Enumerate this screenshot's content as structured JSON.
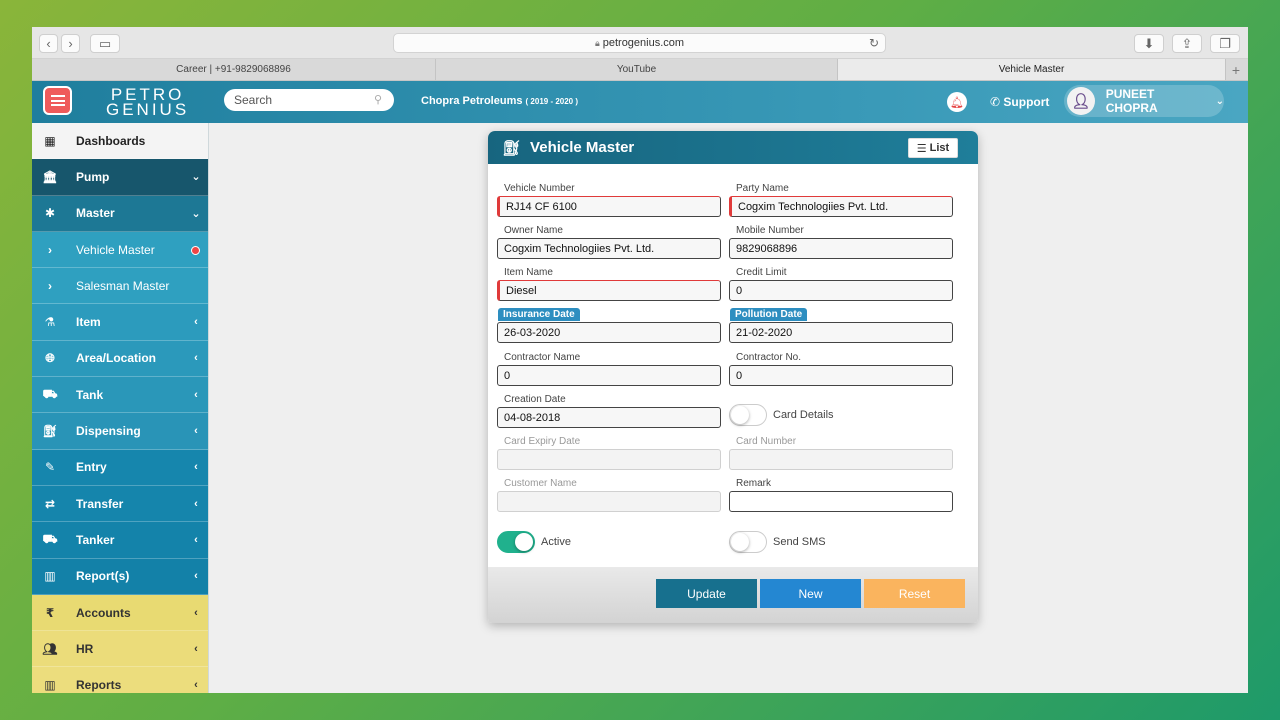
{
  "browser": {
    "url": "petrogenius.com",
    "tabs": [
      "Career | +91-9829068896",
      "YouTube",
      "Vehicle Master"
    ],
    "active_tab": 2
  },
  "header": {
    "logo_line1": "PETRO",
    "logo_line2": "GENIUS",
    "search_placeholder": "Search",
    "company": "Chopra Petroleums",
    "year": "( 2019 - 2020 )",
    "support_label": "Support",
    "user_name": "PUNEET CHOPRA"
  },
  "sidebar": {
    "items": [
      {
        "label": "Dashboards",
        "icon": "grid-icon",
        "caret": "",
        "bg": "#f4f4f4",
        "fg": "#222"
      },
      {
        "label": "Pump",
        "icon": "bank-icon",
        "caret": "⌄",
        "bg": "#17566c",
        "fg": "#fff"
      },
      {
        "label": "Master",
        "icon": "asterisk-icon",
        "caret": "⌄",
        "bg": "#1d7895",
        "fg": "#fff"
      },
      {
        "label": "Vehicle Master",
        "icon": "chevron-right-icon",
        "caret": "",
        "bg": "#2fa0c0",
        "fg": "#fff",
        "sub": true,
        "dot": true
      },
      {
        "label": "Salesman Master",
        "icon": "chevron-right-icon",
        "caret": "",
        "bg": "#2fa0c0",
        "fg": "#fff",
        "sub": true
      },
      {
        "label": "Item",
        "icon": "drops-icon",
        "caret": "‹",
        "bg": "#2c9bbd",
        "fg": "#fff"
      },
      {
        "label": "Area/Location",
        "icon": "globe-icon",
        "caret": "‹",
        "bg": "#2b99bb",
        "fg": "#fff"
      },
      {
        "label": "Tank",
        "icon": "truck-icon",
        "caret": "‹",
        "bg": "#2a97b9",
        "fg": "#fff"
      },
      {
        "label": "Dispensing",
        "icon": "fuel-pump-icon",
        "caret": "‹",
        "bg": "#2994b7",
        "fg": "#fff"
      },
      {
        "label": "Entry",
        "icon": "edit-icon",
        "caret": "‹",
        "bg": "#1686ad",
        "fg": "#fff"
      },
      {
        "label": "Transfer",
        "icon": "exchange-icon",
        "caret": "‹",
        "bg": "#1585ac",
        "fg": "#fff"
      },
      {
        "label": "Tanker",
        "icon": "tanker-truck-icon",
        "caret": "‹",
        "bg": "#1483aa",
        "fg": "#fff"
      },
      {
        "label": "Report(s)",
        "icon": "bar-chart-icon",
        "caret": "‹",
        "bg": "#1381a8",
        "fg": "#fff"
      },
      {
        "label": "Accounts",
        "icon": "rupee-icon",
        "caret": "‹",
        "bg": "#e8da72",
        "fg": "#333"
      },
      {
        "label": "HR",
        "icon": "users-icon",
        "caret": "‹",
        "bg": "#ebdc7a",
        "fg": "#333"
      },
      {
        "label": "Reports",
        "icon": "bar-chart-icon",
        "caret": "‹",
        "bg": "#ecdd7d",
        "fg": "#333"
      }
    ]
  },
  "form": {
    "title": "Vehicle Master",
    "list_label": "List",
    "vehicle_number": {
      "label": "Vehicle Number",
      "value": "RJ14 CF 6100"
    },
    "party_name": {
      "label": "Party Name",
      "value": "Cogxim Technologiies Pvt. Ltd."
    },
    "owner_name": {
      "label": "Owner Name",
      "value": "Cogxim Technologiies Pvt. Ltd."
    },
    "mobile_number": {
      "label": "Mobile Number",
      "value": "9829068896"
    },
    "item_name": {
      "label": "Item Name",
      "value": "Diesel"
    },
    "credit_limit": {
      "label": "Credit Limit",
      "value": "0"
    },
    "insurance_date": {
      "label": "Insurance Date",
      "value": "26-03-2020"
    },
    "pollution_date": {
      "label": "Pollution Date",
      "value": "21-02-2020"
    },
    "contractor_name": {
      "label": "Contractor Name",
      "value": "0"
    },
    "contractor_no": {
      "label": "Contractor No.",
      "value": "0"
    },
    "creation_date": {
      "label": "Creation Date",
      "value": "04-08-2018"
    },
    "card_details_label": "Card Details",
    "card_expiry_date": {
      "label": "Card Expiry Date",
      "value": ""
    },
    "card_number": {
      "label": "Card Number",
      "value": ""
    },
    "customer_name": {
      "label": "Customer Name",
      "value": ""
    },
    "remark": {
      "label": "Remark",
      "value": ""
    },
    "active_label": "Active",
    "send_sms_label": "Send SMS",
    "update_label": "Update",
    "new_label": "New",
    "reset_label": "Reset"
  }
}
